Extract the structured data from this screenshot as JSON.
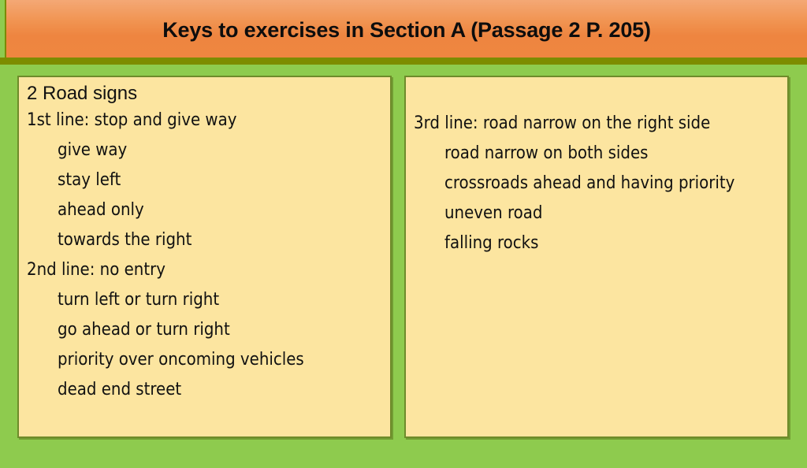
{
  "slide": {
    "title": "Keys to exercises in Section A (Passage 2 P. 205)",
    "colors": {
      "background_green": "#8ECB4E",
      "banner_orange": "#EE8540",
      "banner_shadow_olive": "#7D8C00",
      "panel_fill": "#FCE5A0",
      "panel_border": "#6E8B2A",
      "text": "#111111"
    }
  },
  "left_panel": {
    "heading": "2 Road signs",
    "groups": [
      {
        "label": "1st line: stop and give way",
        "items": [
          "give way",
          "stay left",
          "ahead only",
          "towards the right"
        ]
      },
      {
        "label": "2nd line: no entry",
        "items": [
          "turn left or turn right",
          "go ahead or turn right",
          "priority over oncoming vehicles",
          "dead end street"
        ]
      }
    ]
  },
  "right_panel": {
    "groups": [
      {
        "label": "3rd line: road narrow on the right side",
        "items": [
          "road narrow on both sides",
          "crossroads ahead and having priority",
          "uneven road",
          "falling rocks"
        ]
      }
    ]
  }
}
